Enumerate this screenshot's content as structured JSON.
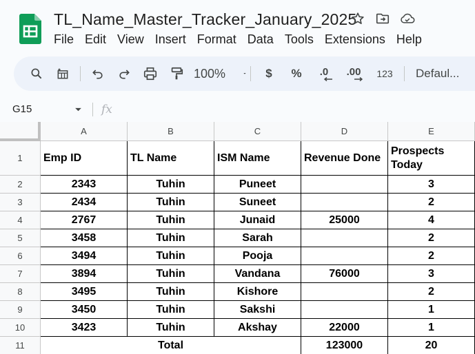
{
  "title": "TL_Name_Master_Tracker_January_2025",
  "menu": [
    "File",
    "Edit",
    "View",
    "Insert",
    "Format",
    "Data",
    "Tools",
    "Extensions",
    "Help"
  ],
  "toolbar": {
    "zoom": "100%",
    "currency": "$",
    "percent": "%",
    "decrease_decimal": ".0",
    "increase_decimal": ".00",
    "number_format": "123",
    "font": "Defaul..."
  },
  "formula_bar": {
    "name_box": "G15",
    "fx": "fx"
  },
  "columns": [
    "A",
    "B",
    "C",
    "D",
    "E"
  ],
  "row_numbers": [
    "1",
    "2",
    "3",
    "4",
    "5",
    "6",
    "7",
    "8",
    "9",
    "10",
    "11"
  ],
  "header_row": [
    "Emp ID",
    "TL Name",
    "ISM Name",
    "Revenue Done",
    "Prospects Today"
  ],
  "rows": [
    [
      "2343",
      "Tuhin",
      "Puneet",
      "",
      "3"
    ],
    [
      "2434",
      "Tuhin",
      "Suneet",
      "",
      "2"
    ],
    [
      "2767",
      "Tuhin",
      "Junaid",
      "25000",
      "4"
    ],
    [
      "3458",
      "Tuhin",
      "Sarah",
      "",
      "2"
    ],
    [
      "3494",
      "Tuhin",
      "Pooja",
      "",
      "2"
    ],
    [
      "3894",
      "Tuhin",
      "Vandana",
      "76000",
      "3"
    ],
    [
      "3495",
      "Tuhin",
      "Kishore",
      "",
      "2"
    ],
    [
      "3450",
      "Tuhin",
      "Sakshi",
      "",
      "1"
    ],
    [
      "3423",
      "Tuhin",
      "Akshay",
      "22000",
      "1"
    ]
  ],
  "total_row": {
    "label": "Total",
    "revenue": "123000",
    "prospects": "20"
  },
  "colors": {
    "brand_green": "#0f9d58",
    "toolbar_bg": "#edf2fa"
  }
}
